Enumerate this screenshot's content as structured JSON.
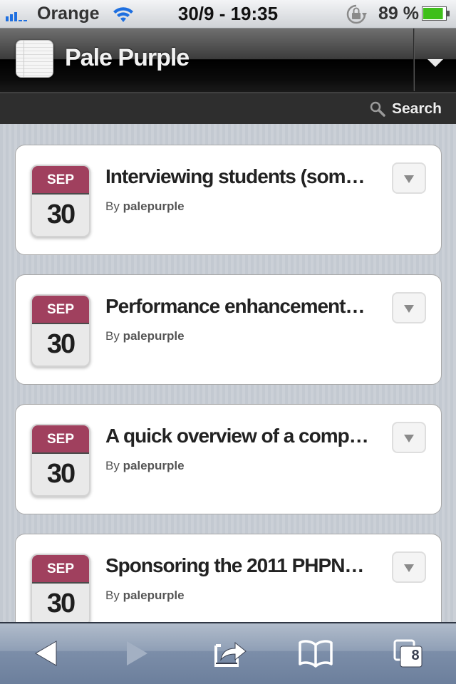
{
  "status_bar": {
    "carrier": "Orange",
    "time": "30/9 - 19:35",
    "battery_percent": "89 %",
    "battery_level": 0.89,
    "signal_bars": 3,
    "signal_bars_total": 5
  },
  "header": {
    "site_title": "Pale Purple",
    "menu_toggle_icon": "chevron-down-icon"
  },
  "search": {
    "label": "Search",
    "icon": "search-icon"
  },
  "posts": [
    {
      "month": "SEP",
      "day": "30",
      "title": "Interviewing students (som…",
      "by_label": "By",
      "author": "palepurple"
    },
    {
      "month": "SEP",
      "day": "30",
      "title": "Performance enhancement…",
      "by_label": "By",
      "author": "palepurple"
    },
    {
      "month": "SEP",
      "day": "30",
      "title": "A quick overview of a comp…",
      "by_label": "By",
      "author": "palepurple"
    },
    {
      "month": "SEP",
      "day": "30",
      "title": "Sponsoring the 2011 PHPN…",
      "by_label": "By",
      "author": "palepurple"
    }
  ],
  "toolbar": {
    "back": "back-icon",
    "forward": "forward-icon",
    "share": "share-icon",
    "bookmarks": "bookmarks-icon",
    "tabs": "tabs-icon",
    "tab_count": "8"
  },
  "colors": {
    "calendar_month": "#a0405e",
    "signal": "#1e6fe0",
    "battery": "#3fbf1a"
  }
}
